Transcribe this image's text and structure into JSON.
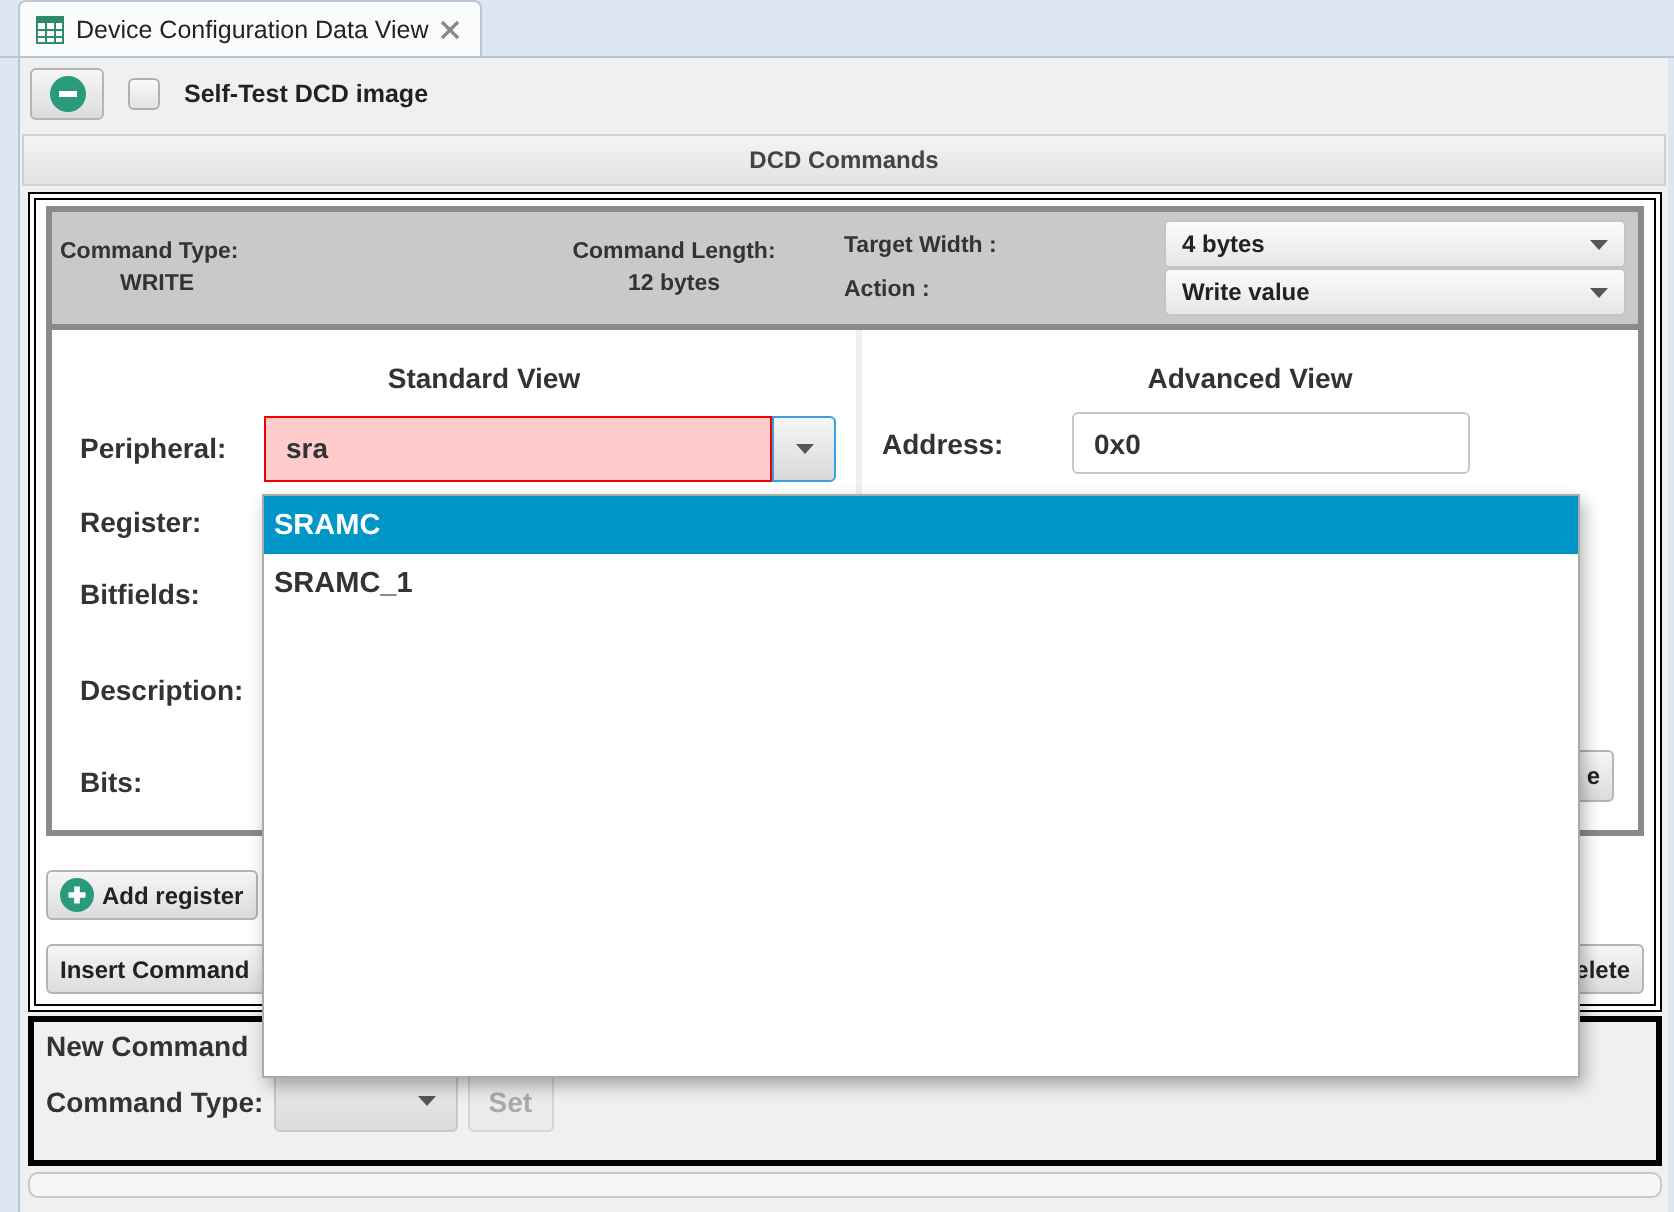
{
  "tab": {
    "title": "Device Configuration Data View",
    "selected": true
  },
  "self_test": {
    "label": "Self-Test DCD image",
    "checked": false
  },
  "section_title": "DCD Commands",
  "command_header": {
    "command_type_label": "Command Type:",
    "command_type": "WRITE",
    "command_length_label": "Command Length:",
    "command_length": "12 bytes",
    "target_width_label": "Target Width :",
    "target_width": "4 bytes",
    "action_label": "Action :",
    "action": "Write value"
  },
  "standard_view": {
    "title": "Standard View",
    "fields": [
      {
        "label": "Peripheral:",
        "kind": "combo",
        "value": "sra",
        "invalid": true,
        "focused": true
      },
      {
        "label": "Register:",
        "kind": "label"
      },
      {
        "label": "Bitfields:",
        "kind": "label"
      },
      {
        "label": "Description:",
        "kind": "label"
      },
      {
        "label": "Bits:",
        "kind": "label"
      }
    ]
  },
  "advanced_view": {
    "title": "Advanced View",
    "address_label": "Address:",
    "address": "0x0",
    "button": "e"
  },
  "buttons": {
    "add_register": "Add register",
    "insert": "Insert Command",
    "delete": "elete"
  },
  "new_command": {
    "title": "New Command",
    "type_label": "Command Type:",
    "set_button": {
      "label": "Set",
      "disabled": true
    }
  },
  "peripheral_popup": [
    {
      "label": "SRAMC",
      "selected": true
    },
    {
      "label": "SRAMC_1",
      "selected": false
    }
  ]
}
